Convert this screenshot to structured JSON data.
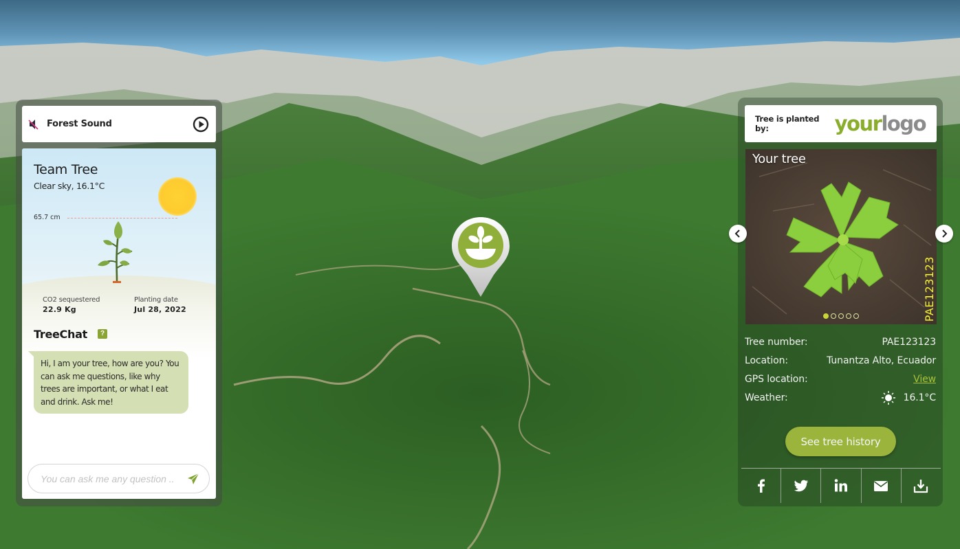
{
  "sound": {
    "title": "Forest Sound",
    "muted": true
  },
  "tree_card": {
    "name": "Team Tree",
    "weather": "Clear sky, 16.1°C",
    "height_label": "65.7 cm",
    "co2_label": "CO2 sequestered",
    "co2_value": "22.9 Kg",
    "planting_label": "Planting date",
    "planting_value": "Jul 28, 2022"
  },
  "chat": {
    "title": "TreeChat",
    "help_label": "?",
    "message": "Hi, I am your tree, how are you? You can ask me questions, like why trees are important, or what I eat and drink. Ask me!",
    "input_value": "",
    "input_placeholder": "You can ask me any question .."
  },
  "sponsor": {
    "label": "Tree is planted by:",
    "logo_part1": "your",
    "logo_part2": "logo"
  },
  "photo": {
    "title": "Your tree",
    "overlay_id": "PAE123123",
    "slide_count": 5,
    "active_slide": 1
  },
  "details": {
    "rows": [
      {
        "key": "Tree number:",
        "value": "PAE123123"
      },
      {
        "key": "Location:",
        "value": "Tunantza Alto, Ecuador"
      },
      {
        "key": "GPS location:",
        "value": "View"
      },
      {
        "key": "Weather:",
        "value": "16.1°C",
        "icon": "sun-icon"
      }
    ]
  },
  "actions": {
    "history_label": "See tree history",
    "share": [
      "facebook-icon",
      "twitter-icon",
      "linkedin-icon",
      "email-icon",
      "download-icon"
    ]
  },
  "colors": {
    "accent_green": "#9ab43c",
    "logo_green": "#8aad2e",
    "logo_grey": "#8b8b8b",
    "chat_bubble": "#d5dfb4",
    "photo_id_yellow": "#f5f032"
  }
}
